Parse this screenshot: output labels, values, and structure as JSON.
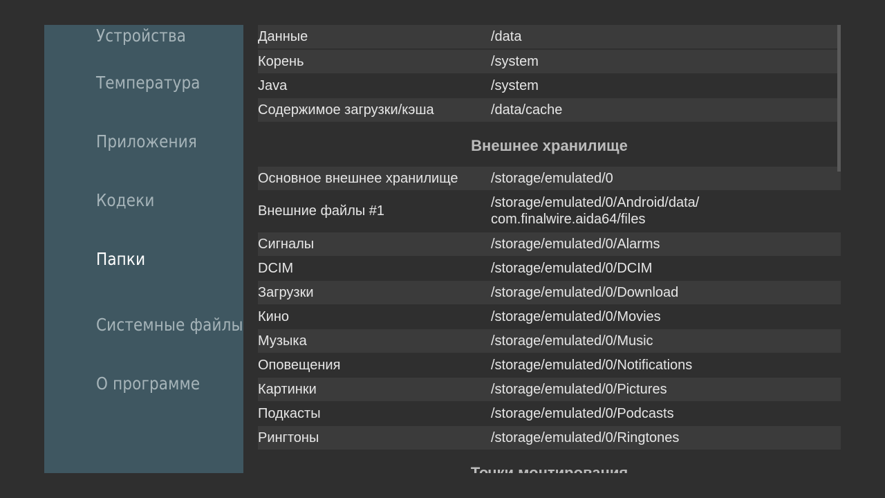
{
  "sidebar": {
    "items": [
      {
        "label": "Устройства",
        "active": false
      },
      {
        "label": "Температура",
        "active": false
      },
      {
        "label": "Приложения",
        "active": false
      },
      {
        "label": "Кодеки",
        "active": false
      },
      {
        "label": "Папки",
        "active": true
      },
      {
        "label": "Системные файлы",
        "active": false
      },
      {
        "label": "О программе",
        "active": false
      }
    ]
  },
  "content": {
    "system_rows": [
      {
        "key": "Данные",
        "value": "/data"
      },
      {
        "key": "Корень",
        "value": "/system"
      },
      {
        "key": "Java",
        "value": "/system"
      },
      {
        "key": "Содержимое загрузки/кэша",
        "value": "/data/cache"
      }
    ],
    "external_storage_title": "Внешнее хранилище",
    "external_rows": [
      {
        "key": "Основное внешнее хранилище",
        "value": "/storage/emulated/0"
      },
      {
        "key": "Внешние файлы #1",
        "value_line1": "/storage/emulated/0/Android/data/",
        "value_line2": "com.finalwire.aida64/files"
      },
      {
        "key": "Сигналы",
        "value": "/storage/emulated/0/Alarms"
      },
      {
        "key": "DCIM",
        "value": "/storage/emulated/0/DCIM"
      },
      {
        "key": "Загрузки",
        "value": "/storage/emulated/0/Download"
      },
      {
        "key": "Кино",
        "value": "/storage/emulated/0/Movies"
      },
      {
        "key": "Музыка",
        "value": "/storage/emulated/0/Music"
      },
      {
        "key": "Оповещения",
        "value": "/storage/emulated/0/Notifications"
      },
      {
        "key": "Картинки",
        "value": "/storage/emulated/0/Pictures"
      },
      {
        "key": "Подкасты",
        "value": "/storage/emulated/0/Podcasts"
      },
      {
        "key": "Рингтоны",
        "value": "/storage/emulated/0/Ringtones"
      }
    ],
    "mount_points_title": "Точки монтирования"
  },
  "colors": {
    "background": "#2f2f2f",
    "sidebar": "#3f5761",
    "row_shade": "#3b3b3b",
    "nav_text": "#a6b4b9",
    "nav_active": "#ffffff"
  }
}
